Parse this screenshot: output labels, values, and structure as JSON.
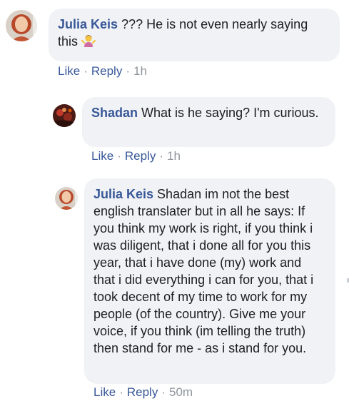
{
  "comments": [
    {
      "author": "Julia Keis",
      "text": " ??? He is not even nearly saying this ",
      "emoji": "person-shrugging-emoji",
      "actions": {
        "like": "Like",
        "reply": "Reply",
        "separator": "·",
        "time": "1h"
      }
    },
    {
      "author": "Shadan",
      "text": " What is he saying? I'm curious.",
      "actions": {
        "like": "Like",
        "reply": "Reply",
        "separator": "·",
        "time": "1h"
      }
    },
    {
      "author": "Julia Keis",
      "text": " Shadan im not the best english translater but in all he says: If you think my work is right, if you think i was diligent, that i done all for you this year, that i have done (my) work and that i did everything i can for you, that i took decent of my time to work for my people (of the country). Give me your voice, if you think (im telling the truth) then stand for me - as i stand for you.",
      "actions": {
        "like": "Like",
        "reply": "Reply",
        "separator": "·",
        "time": "50m"
      }
    }
  ],
  "colors": {
    "author_link": "#385898",
    "bubble_bg": "#f0f2f5",
    "meta_gray": "#90949c"
  }
}
